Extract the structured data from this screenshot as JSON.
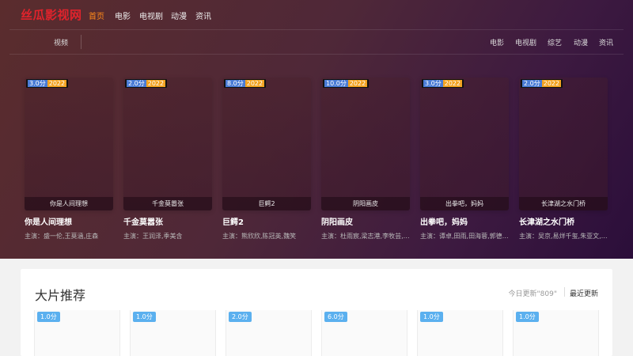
{
  "site": {
    "logo": "丝瓜影视网"
  },
  "topnav": [
    {
      "label": "首页",
      "active": true
    },
    {
      "label": "电影",
      "active": false
    },
    {
      "label": "电视剧",
      "active": false
    },
    {
      "label": "动漫",
      "active": false
    },
    {
      "label": "资讯",
      "active": false
    }
  ],
  "subnav": {
    "left": "视频",
    "right": [
      "电影",
      "电视剧",
      "综艺",
      "动漫",
      "资讯"
    ]
  },
  "hero_cards": [
    {
      "score": "3.0分",
      "year": "2022",
      "poster_title": "你是人间理想",
      "title": "你是人间理想",
      "cast": "主演：盛一伦,王莫涵,庄森"
    },
    {
      "score": "2.0分",
      "year": "2022",
      "poster_title": "千金莫嚣张",
      "title": "千金莫嚣张",
      "cast": "主演：王润泽,季美含"
    },
    {
      "score": "8.0分",
      "year": "2022",
      "poster_title": "巨鳄2",
      "title": "巨鳄2",
      "cast": "主演：熊欣欣,陈冠英,魏笑"
    },
    {
      "score": "10.0分",
      "year": "2022",
      "poster_title": "阴阳画皮",
      "title": "阴阳画皮",
      "cast": "主演：杜雨宸,梁志港,李牧芸,孙..."
    },
    {
      "score": "3.0分",
      "year": "2022",
      "poster_title": "出拳吧，妈妈",
      "title": "出拳吧，妈妈",
      "cast": "主演：谭卓,田雨,田海蓉,郭德维..."
    },
    {
      "score": "2.0分",
      "year": "2022",
      "poster_title": "长津湖之水门桥",
      "title": "长津湖之水门桥",
      "cast": "主演：吴京,易烊千玺,朱亚文,李..."
    }
  ],
  "recommend": {
    "title": "大片推荐",
    "today_update": "今日更新\"809\"",
    "latest_label": "最近更新",
    "cards": [
      {
        "score": "1.0分"
      },
      {
        "score": "1.0分"
      },
      {
        "score": "2.0分"
      },
      {
        "score": "6.0分"
      },
      {
        "score": "1.0分"
      },
      {
        "score": "1.0分"
      }
    ]
  },
  "colors": {
    "logo": "#e0232c",
    "active_nav": "#ff8a1a",
    "score_badge": "#4a7cd6",
    "year_badge": "#f3a321",
    "rec_score_badge": "#5bb0ef"
  }
}
